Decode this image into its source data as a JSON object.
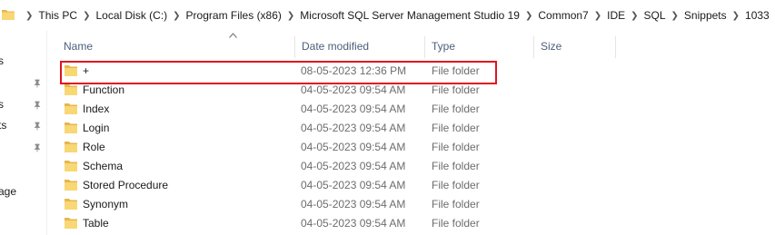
{
  "breadcrumbs": [
    "This PC",
    "Local Disk (C:)",
    "Program Files (x86)",
    "Microsoft SQL Server Management Studio 19",
    "Common7",
    "IDE",
    "SQL",
    "Snippets",
    "1033"
  ],
  "nav": {
    "fragments": [
      "s",
      "s",
      "ts",
      "age"
    ]
  },
  "columns": {
    "name": "Name",
    "date": "Date modified",
    "type": "Type",
    "size": "Size"
  },
  "rows": [
    {
      "name": "+",
      "date": "08-05-2023 12:36 PM",
      "type": "File folder"
    },
    {
      "name": "Function",
      "date": "04-05-2023 09:54 AM",
      "type": "File folder"
    },
    {
      "name": "Index",
      "date": "04-05-2023 09:54 AM",
      "type": "File folder"
    },
    {
      "name": "Login",
      "date": "04-05-2023 09:54 AM",
      "type": "File folder"
    },
    {
      "name": "Role",
      "date": "04-05-2023 09:54 AM",
      "type": "File folder"
    },
    {
      "name": "Schema",
      "date": "04-05-2023 09:54 AM",
      "type": "File folder"
    },
    {
      "name": "Stored Procedure",
      "date": "04-05-2023 09:54 AM",
      "type": "File folder"
    },
    {
      "name": "Synonym",
      "date": "04-05-2023 09:54 AM",
      "type": "File folder"
    },
    {
      "name": "Table",
      "date": "04-05-2023 09:54 AM",
      "type": "File folder"
    }
  ],
  "colors": {
    "folder": "#f8d775",
    "folder_dark": "#e8b64c",
    "highlight": "#e0141e",
    "header_text": "#4c607a"
  },
  "icons": {
    "folder": "folder-icon",
    "chevron": "chevron-right-icon",
    "pin": "pin-icon",
    "sort": "sort-ascending-icon"
  }
}
